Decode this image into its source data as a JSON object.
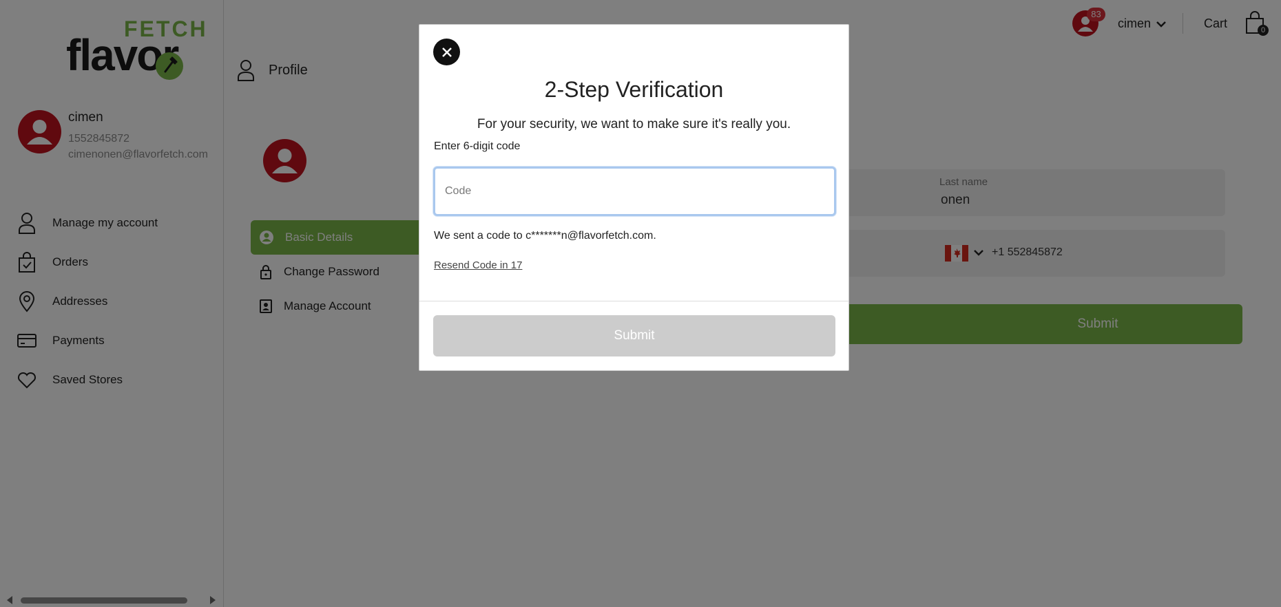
{
  "brand": {
    "logo_top": "FETCH",
    "logo_bottom": "flavor",
    "accent_color": "#7ab648",
    "avatar_color": "#c0121f"
  },
  "header": {
    "notification_count": "83",
    "user_name": "cimen",
    "cart_label": "Cart",
    "cart_count": "0"
  },
  "page": {
    "title": "Profile"
  },
  "sidebar": {
    "user": {
      "name": "cimen",
      "phone": "1552845872",
      "email": "cimenonen@flavorfetch.com"
    },
    "items": [
      {
        "label": "Manage my account",
        "icon": "person-outline-icon"
      },
      {
        "label": "Orders",
        "icon": "shopping-bag-icon"
      },
      {
        "label": "Addresses",
        "icon": "map-pin-icon"
      },
      {
        "label": "Payments",
        "icon": "credit-card-icon"
      },
      {
        "label": "Saved Stores",
        "icon": "heart-icon"
      }
    ]
  },
  "profile": {
    "tabs": [
      {
        "label": "Basic Details",
        "icon": "user-circle-icon",
        "active": true
      },
      {
        "label": "Change Password",
        "icon": "lock-icon",
        "active": false
      },
      {
        "label": "Manage Account",
        "icon": "id-card-icon",
        "active": false
      }
    ],
    "last_name_label": "Last name",
    "last_name_value": "onen",
    "phone_value": "+1 552845872",
    "submit_label": "Submit"
  },
  "modal": {
    "title": "2-Step Verification",
    "subtitle": "For your security, we want to make sure it's really you.",
    "code_label": "Enter 6-digit code",
    "code_placeholder": "Code",
    "code_value": "",
    "sent_text": "We sent a code to c*******n@flavorfetch.com.",
    "resend_text": "Resend Code in 17",
    "submit_label": "Submit"
  }
}
